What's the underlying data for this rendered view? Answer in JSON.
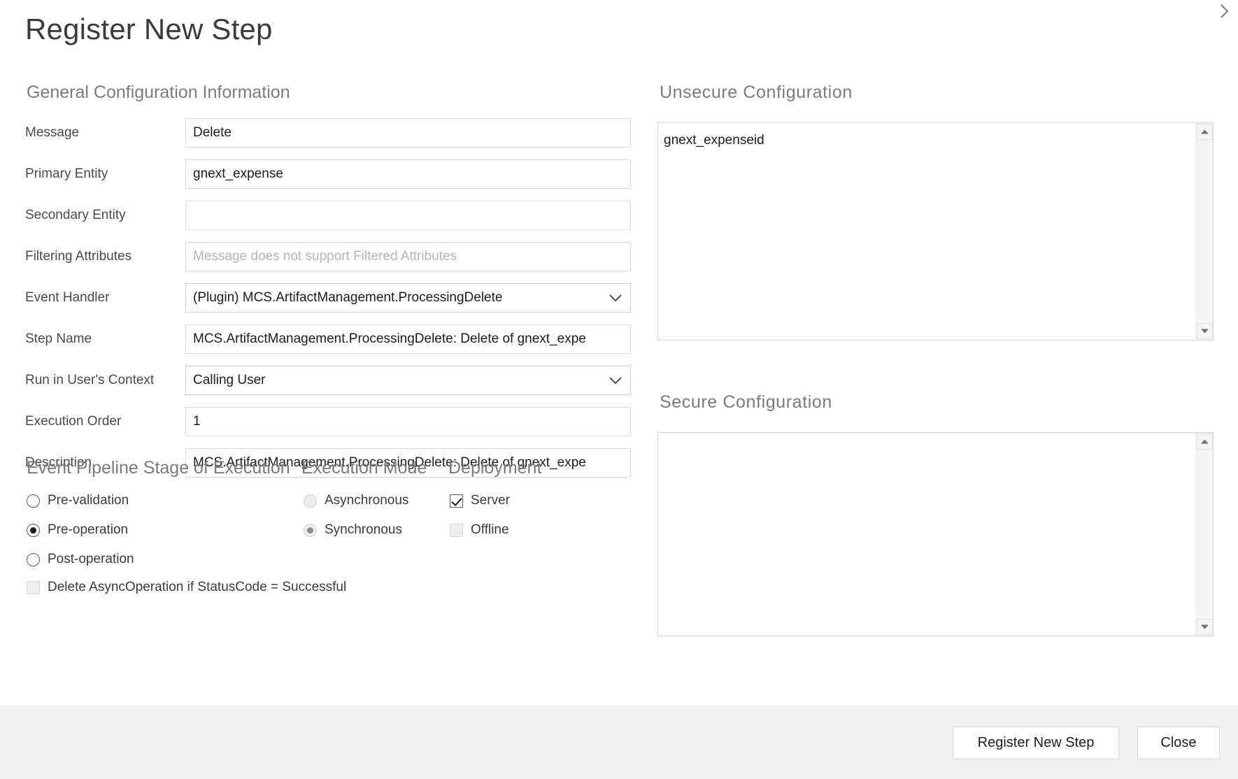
{
  "dialog": {
    "title": "Register New Step"
  },
  "general": {
    "heading": "General Configuration Information",
    "fields": [
      {
        "label": "Message",
        "value": "Delete",
        "placeholder": "",
        "type": "text"
      },
      {
        "label": "Primary Entity",
        "value": "gnext_expense",
        "placeholder": "",
        "type": "text"
      },
      {
        "label": "Secondary Entity",
        "value": "",
        "placeholder": "",
        "type": "text"
      },
      {
        "label": "Filtering Attributes",
        "value": "",
        "placeholder": "Message does not support Filtered Attributes",
        "type": "text"
      },
      {
        "label": "Event Handler",
        "value": "(Plugin) MCS.ArtifactManagement.ProcessingDelete",
        "placeholder": "",
        "type": "combo"
      },
      {
        "label": "Step Name",
        "value": "MCS.ArtifactManagement.ProcessingDelete: Delete of gnext_expe",
        "placeholder": "",
        "type": "text"
      },
      {
        "label": "Run in User's Context",
        "value": "Calling User",
        "placeholder": "",
        "type": "combo"
      },
      {
        "label": "Execution Order",
        "value": "1",
        "placeholder": "",
        "type": "text"
      },
      {
        "label": "Description",
        "value": "MCS.ArtifactManagement.ProcessingDelete: Delete of gnext_expe",
        "placeholder": "",
        "type": "text"
      }
    ]
  },
  "options": {
    "stage_heading": "Event Pipeline Stage of Execution",
    "mode_heading": "Execution Mode",
    "deployment_heading": "Deployment",
    "stage_options": [
      {
        "label": "Pre-validation",
        "checked": false
      },
      {
        "label": "Pre-operation",
        "checked": true
      },
      {
        "label": "Post-operation",
        "checked": false
      }
    ],
    "async_delete": {
      "label": "Delete AsyncOperation if StatusCode = Successful",
      "checked": false
    },
    "mode_options": [
      {
        "label": "Asynchronous",
        "checked": false
      },
      {
        "label": "Synchronous",
        "checked": true
      }
    ],
    "deployment_options": [
      {
        "label": "Server",
        "checked": true
      },
      {
        "label": "Offline",
        "checked": false
      }
    ]
  },
  "unsecure": {
    "heading": "Unsecure  Configuration",
    "value": "gnext_expenseid"
  },
  "secure": {
    "heading": "Secure  Configuration",
    "value": ""
  },
  "footer": {
    "register_label": "Register New Step",
    "close_label": "Close"
  },
  "icons": {
    "chevron_down": "chevron-down-icon",
    "scroll_up": "scroll-up-arrow-icon",
    "scroll_down": "scroll-down-arrow-icon"
  },
  "colors": {
    "background": "#ffffff",
    "footer_background": "#f0f0f0",
    "heading_gray": "#7b7b7b",
    "border_gray": "#d8d8d8",
    "text": "#1c1c1c"
  }
}
